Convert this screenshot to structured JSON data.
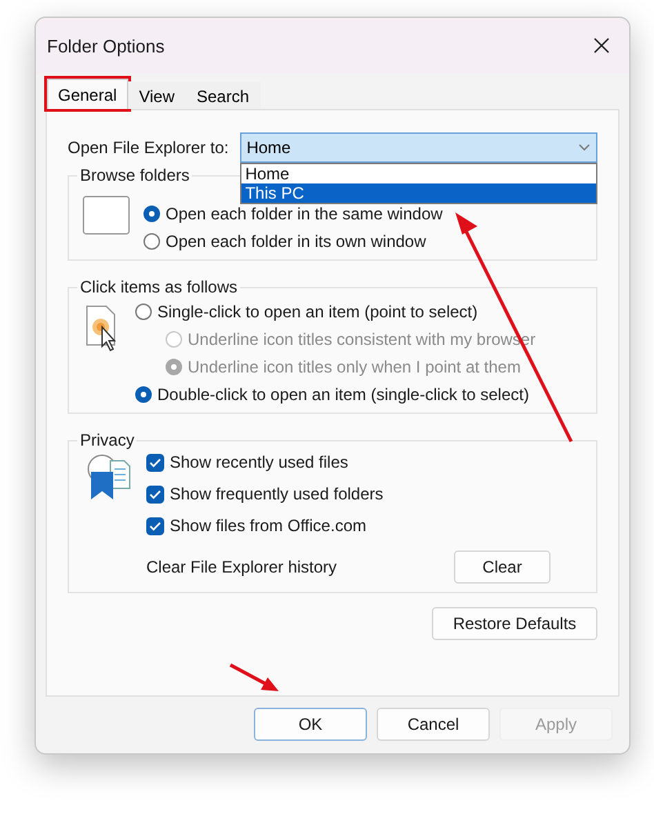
{
  "window": {
    "title": "Folder Options"
  },
  "tabs": [
    {
      "label": "General",
      "selected": true,
      "highlighted": true
    },
    {
      "label": "View",
      "selected": false,
      "highlighted": false
    },
    {
      "label": "Search",
      "selected": false,
      "highlighted": false
    }
  ],
  "open_to": {
    "label": "Open File Explorer to:",
    "value": "Home",
    "expanded": true,
    "options": [
      {
        "label": "Home",
        "highlighted": false
      },
      {
        "label": "This PC",
        "highlighted": true
      }
    ]
  },
  "browse_folders": {
    "title": "Browse folders",
    "options": [
      {
        "label": "Open each folder in the same window",
        "selected": true
      },
      {
        "label": "Open each folder in its own window",
        "selected": false
      }
    ]
  },
  "click_items": {
    "title": "Click items as follows",
    "options": [
      {
        "label": "Single-click to open an item (point to select)",
        "selected": false,
        "disabled": false,
        "children": [
          {
            "label": "Underline icon titles consistent with my browser",
            "selected": false,
            "disabled": true
          },
          {
            "label": "Underline icon titles only when I point at them",
            "selected": true,
            "disabled": true
          }
        ]
      },
      {
        "label": "Double-click to open an item (single-click to select)",
        "selected": true,
        "disabled": false
      }
    ]
  },
  "privacy": {
    "title": "Privacy",
    "checkboxes": [
      {
        "label": "Show recently used files",
        "checked": true
      },
      {
        "label": "Show frequently used folders",
        "checked": true
      },
      {
        "label": "Show files from Office.com",
        "checked": true
      }
    ],
    "clear_label": "Clear File Explorer history",
    "clear_button": "Clear"
  },
  "restore_button": "Restore Defaults",
  "buttons": [
    {
      "label": "OK",
      "default": true,
      "disabled": false
    },
    {
      "label": "Cancel",
      "default": false,
      "disabled": false
    },
    {
      "label": "Apply",
      "default": false,
      "disabled": true
    }
  ]
}
